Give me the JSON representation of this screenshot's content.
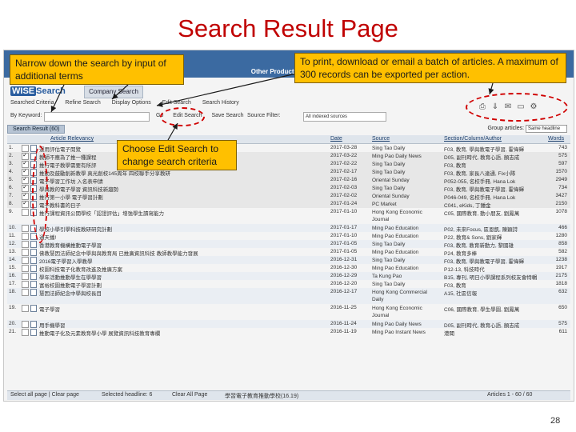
{
  "slide": {
    "title": "Search Result Page",
    "page_number": "28"
  },
  "callouts": {
    "narrow": "Narrow down the search by input of additional terms",
    "export": "To print, download or email a batch of articles. A maximum of 300 records can be exported per action.",
    "edit": "Choose Edit Search to change search criteria"
  },
  "app": {
    "logo_ws": "WISE",
    "logo_rest": "Search",
    "top_link": "Other Products",
    "company_tab": "Company Search",
    "menu": [
      "Searched Criteria",
      "Refine Search",
      "Display Options",
      "Edit Search",
      "Search History"
    ],
    "by_keyword_label": "By Keyword:",
    "row_buttons": [
      "Go",
      "Edit Search",
      "Save Search"
    ],
    "source_filter_label": "Source Filter:",
    "source_filter_value": "All indexed sources",
    "icons": [
      "print-icon",
      "download-icon",
      "email-icon",
      "folder-icon",
      "settings-icon"
    ]
  },
  "results": {
    "tab_label": "Search Result",
    "tab_count": "(60)",
    "group_label": "Group articles:",
    "group_value": "Same headline",
    "columns": {
      "relevancy": "Article Relevancy",
      "date": "Date",
      "source": "Source",
      "section": "Section/Column/Author",
      "words": "Words"
    },
    "rows": [
      {
        "num": "1.",
        "checked": false,
        "title": "運用評估電子閱覽",
        "date": "2017-03-28",
        "source": "Sing Tao Daily",
        "section": "F03, 教育, 學與教電子學習, 霍偉輝",
        "words": "743"
      },
      {
        "num": "2.",
        "checked": true,
        "title": "教師不應為了推一種課程",
        "date": "2017-03-22",
        "source": "Ming Pao Daily News",
        "section": "D05, 副刊時代, 教育心語, 顏志成",
        "words": "575"
      },
      {
        "num": "3.",
        "checked": true,
        "title": "推行電子教學需要有所評",
        "date": "2017-02-22",
        "source": "Sing Tao Daily",
        "section": "F03, 教育",
        "words": "597"
      },
      {
        "num": "4.",
        "checked": true,
        "title": "推動及鼓勵創新教學 真光創校145周年 四校聯手分享教研",
        "date": "2017-02-17",
        "source": "Sing Tao Daily",
        "section": "F03, 教育, 家長八達通, Fix小隊",
        "words": "1570"
      },
      {
        "num": "5.",
        "checked": true,
        "title": "電子學習工作坊 入名表申請",
        "date": "2017-02-16",
        "source": "Oriental Sunday",
        "section": "P052-055, 名校手冊, Hana Lok",
        "words": "2949"
      },
      {
        "num": "6.",
        "checked": true,
        "title": "學與教的電子學習 資訊科技新趨勢",
        "date": "2017-02-03",
        "source": "Sing Tao Daily",
        "section": "F03, 教育, 學與教電子學習, 霍偉輝",
        "words": "734"
      },
      {
        "num": "7.",
        "checked": true,
        "title": "推行第一小學 電子學習計劃",
        "date": "2017-02-02",
        "source": "Oriental Sunday",
        "section": "P046-049, 名校手冊, Hana Lok",
        "words": "3427"
      },
      {
        "num": "8.",
        "checked": true,
        "title": "電子教科書的日子",
        "date": "2017-01-24",
        "source": "PC Market",
        "section": "C041, eKids, 丁鍾金",
        "words": "2150"
      },
      {
        "num": "9.",
        "checked": false,
        "title": "推行課程資訊公開學校「認證評估」增強學生讀寫能力",
        "date": "2017-01-10",
        "source": "Hong Kong Economic Journal",
        "section": "C05, 國際教育, 動小朋友, 劉鳳萬",
        "words": "1078",
        "double": true
      },
      {
        "num": "10.",
        "checked": false,
        "title": "學校小學引學科技教研研究計劃",
        "date": "2017-01-17",
        "source": "Ming Pao Education",
        "section": "P02, 未來Focus, 區恩凱, 陳穎詩",
        "words": "466"
      },
      {
        "num": "11.",
        "checked": false,
        "title": "通天播!",
        "date": "2017-01-10",
        "source": "Ming Pao Education",
        "section": "P22, 教育& Sons, 劉家輝",
        "words": "1280"
      },
      {
        "num": "12.",
        "checked": false,
        "title": "香港教育機構推動電子學習",
        "date": "2017-01-05",
        "source": "Sing Tao Daily",
        "section": "F03, 教育, 教育新動力, 黎國雄",
        "words": "858"
      },
      {
        "num": "13.",
        "checked": false,
        "title": "佛教慧因法師紀念中學與與教育局 已推廣資訊科技 教師教學能力發展",
        "date": "2017-01-05",
        "source": "Ming Pao Education",
        "section": "P24, 教育多棒",
        "words": "582"
      },
      {
        "num": "14.",
        "checked": false,
        "title": "2016電子學習入學教學",
        "date": "2016-12-31",
        "source": "Sing Tao Daily",
        "section": "F03, 教育, 學與教電子學習, 霍偉輝",
        "words": "1238"
      },
      {
        "num": "15.",
        "checked": false,
        "title": "校園科技電子化教育改進及推廣方案",
        "date": "2016-12-30",
        "source": "Ming Pao Education",
        "section": "P12-13, 科技時代",
        "words": "1917"
      },
      {
        "num": "16.",
        "checked": false,
        "title": "學年活動推動學生在學學習",
        "date": "2016-12-29",
        "source": "Ta Kung Pao",
        "section": "B15, 專刊, 明日小學課程系列校友會特輯",
        "words": "2175"
      },
      {
        "num": "17.",
        "checked": false,
        "title": "富裕校園推動電子學習計劃",
        "date": "2016-12-20",
        "source": "Sing Tao Daily",
        "section": "F03, 教育",
        "words": "1818"
      },
      {
        "num": "18.",
        "checked": false,
        "title": "慧因法師紀念中學與校長目",
        "date": "2016-12-17",
        "source": "Hong Kong Commercial Daily",
        "section": "A15, 社區信報",
        "words": "632",
        "double": true
      },
      {
        "num": "19.",
        "checked": false,
        "title": "電子學習",
        "date": "2016-11-25",
        "source": "Hong Kong Economic Journal",
        "section": "C06, 國際教育, 學生學園, 劉鳳萬",
        "words": "650",
        "double": true
      },
      {
        "num": "20.",
        "checked": false,
        "title": "用手機學習",
        "date": "2016-11-24",
        "source": "Ming Pao Daily News",
        "section": "D05, 副刊時代, 教育心語, 顏志成",
        "words": "575"
      },
      {
        "num": "21.",
        "checked": false,
        "title": "推動電子化及元素教育學小學 展覽資訊科技教育專欄",
        "date": "2016-11-19",
        "source": "Ming Pao Instant News",
        "section": "港聞",
        "words": "611"
      }
    ],
    "footer": {
      "left": "Select all page | Clear page",
      "selected": "Selected headline: 6",
      "clear": "Clear All Page",
      "note": "學習電子教育推動學校(16.19)",
      "range": "Articles 1 - 60 / 60"
    }
  }
}
